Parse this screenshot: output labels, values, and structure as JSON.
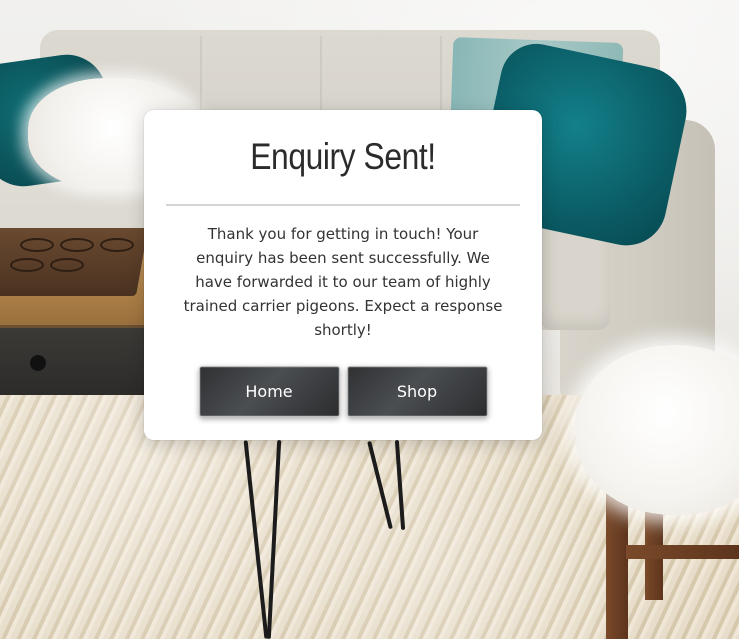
{
  "modal": {
    "title": "Enquiry Sent!",
    "message": "Thank you for getting in touch! Your enquiry has been sent successfully. We have forwarded it to our team of highly trained carrier pigeons. Expect a response shortly!",
    "buttons": {
      "home_label": "Home",
      "shop_label": "Shop"
    }
  },
  "colors": {
    "modal_background": "#ffffff",
    "title_text": "#2b2b2b",
    "body_text": "#333333",
    "button_background": "#3a3c3e",
    "button_text": "#ffffff",
    "divider": "#d4d4d4"
  }
}
